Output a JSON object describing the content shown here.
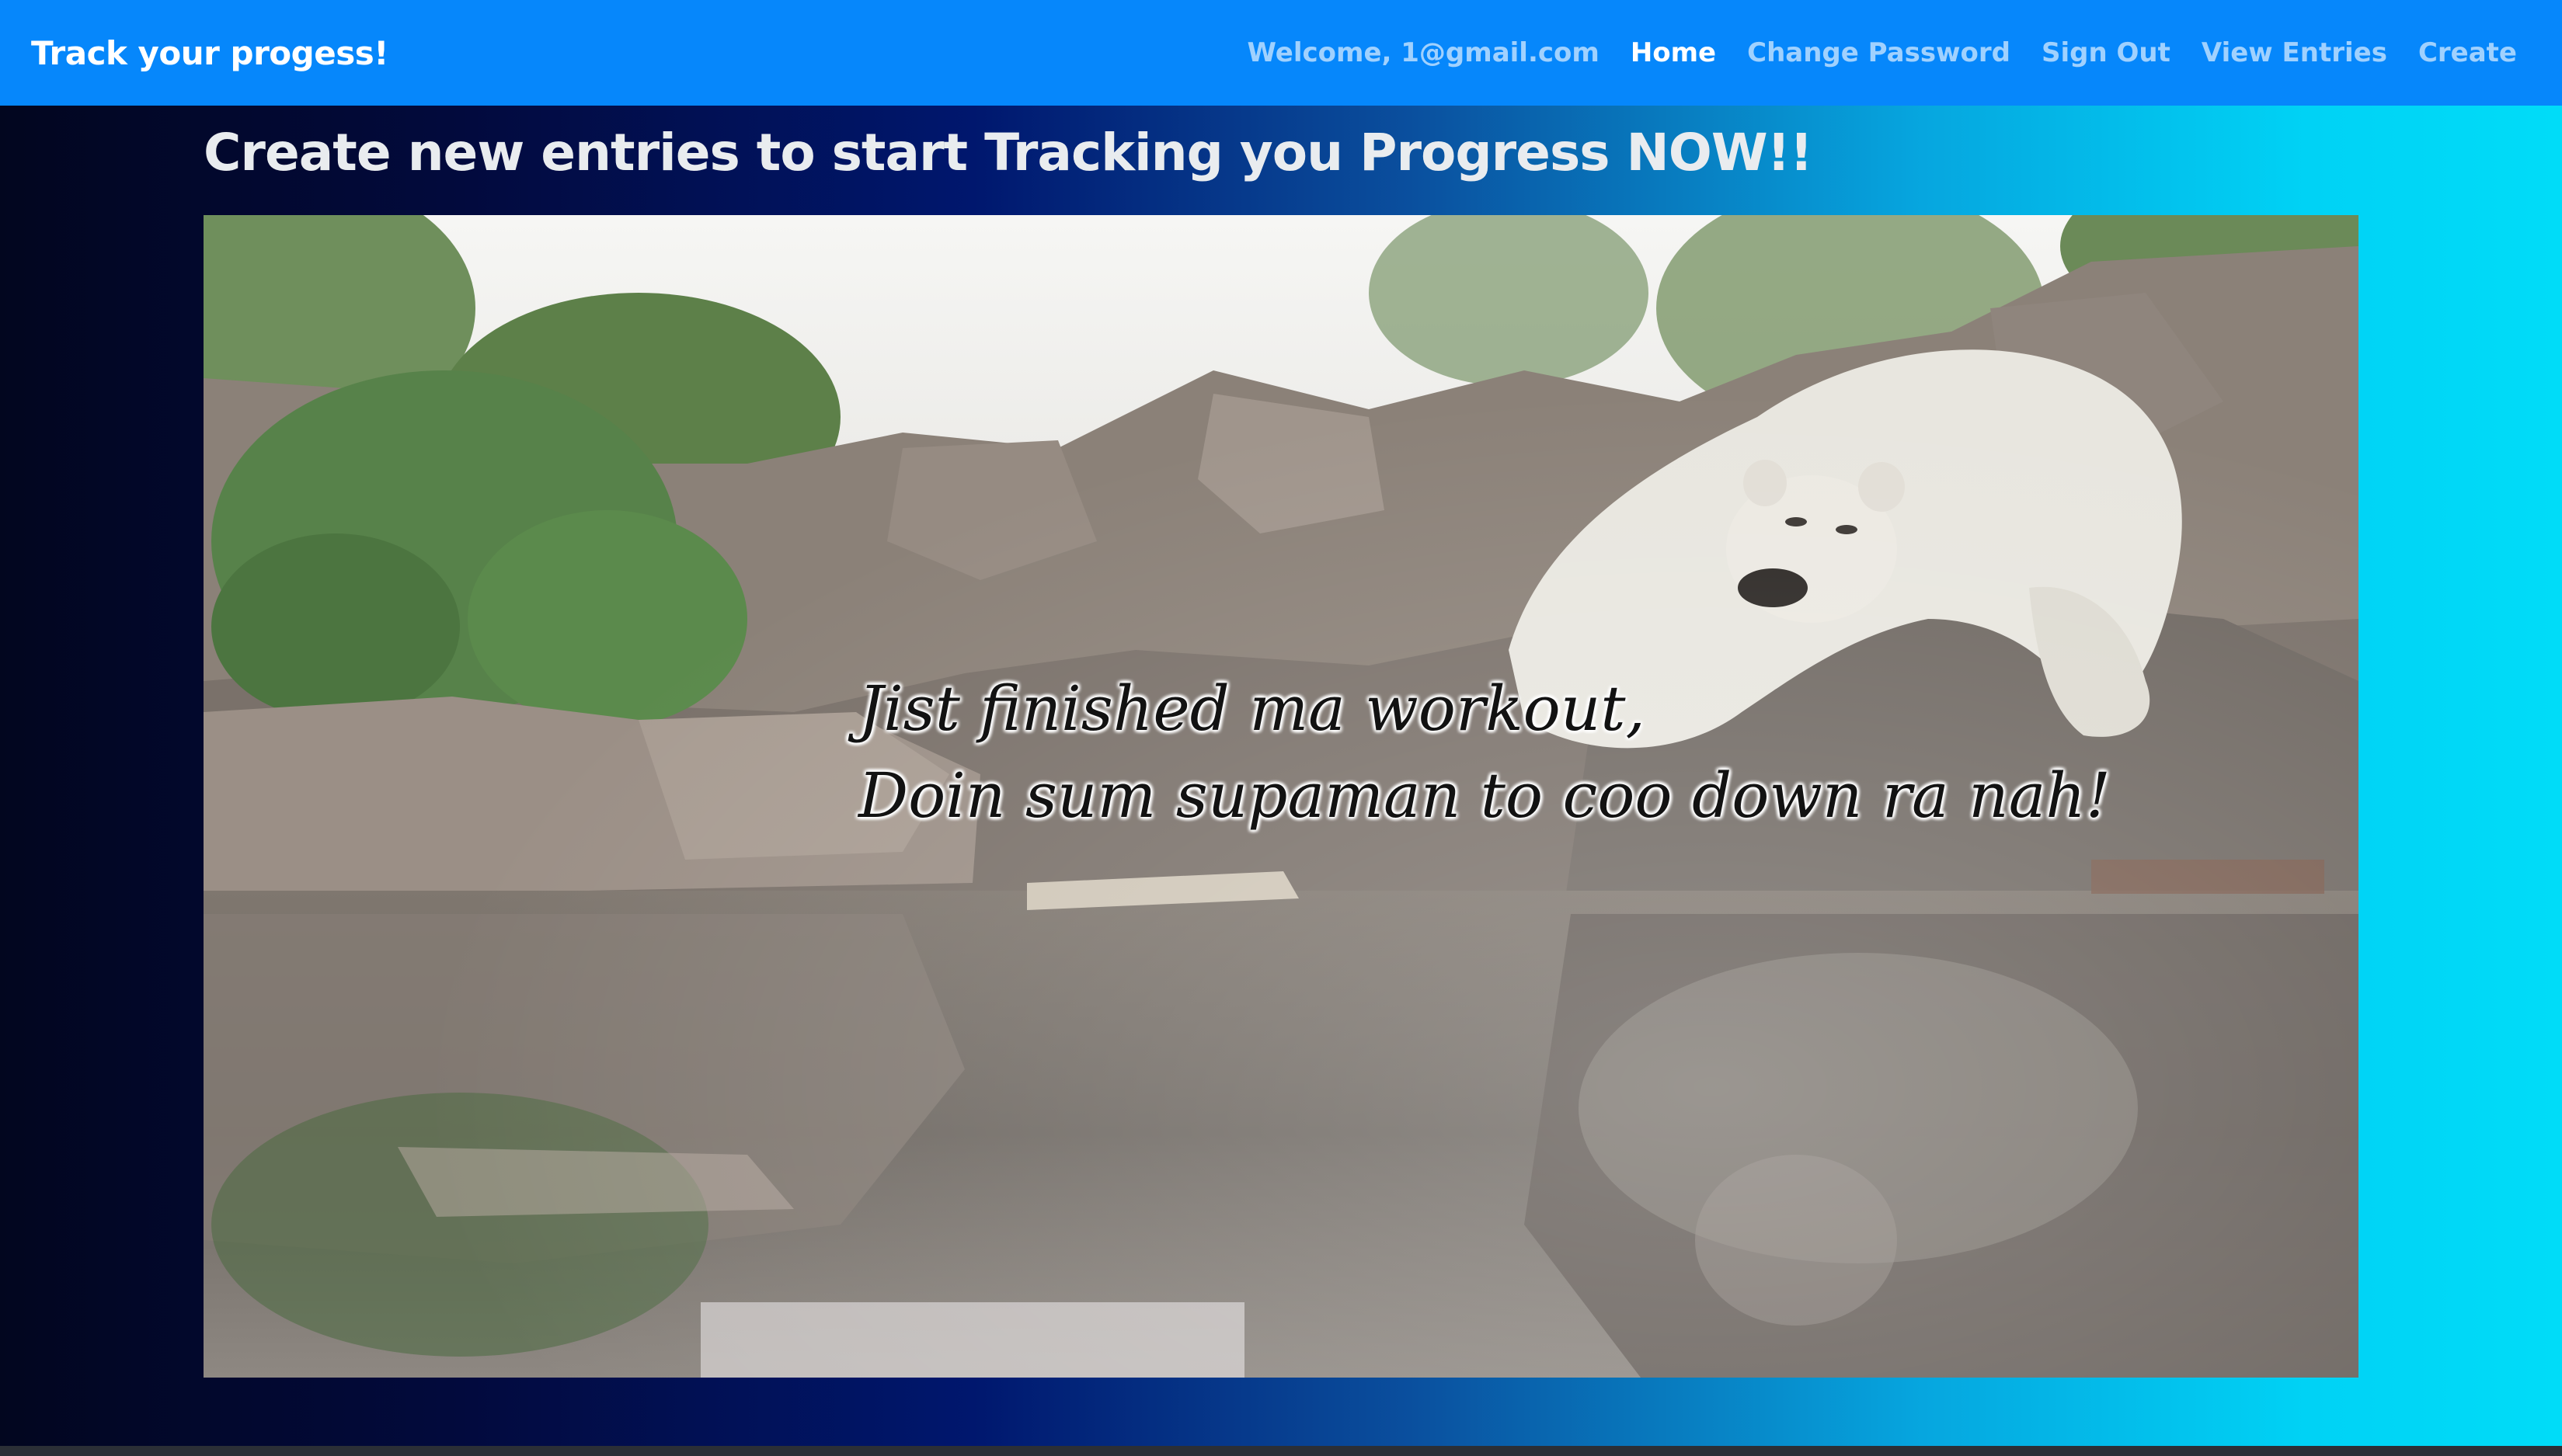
{
  "navbar": {
    "brand": "Track your progess!",
    "welcome": "Welcome, 1@gmail.com",
    "links": [
      {
        "label": "Home",
        "active": true
      },
      {
        "label": "Change Password",
        "active": false
      },
      {
        "label": "Sign Out",
        "active": false
      },
      {
        "label": "View Entries",
        "active": false
      },
      {
        "label": "Create",
        "active": false
      }
    ]
  },
  "main": {
    "headline": "Create new entries to start Tracking you Progress NOW!!",
    "hero_image": {
      "caption_line1": "Jist finished ma workout,",
      "caption_line2": "Doin sum supaman to coo down ra nah!"
    }
  },
  "colors": {
    "navbar_bg": "#0687fb",
    "gradient_left": "#02061f",
    "gradient_right": "#00dcf8"
  }
}
